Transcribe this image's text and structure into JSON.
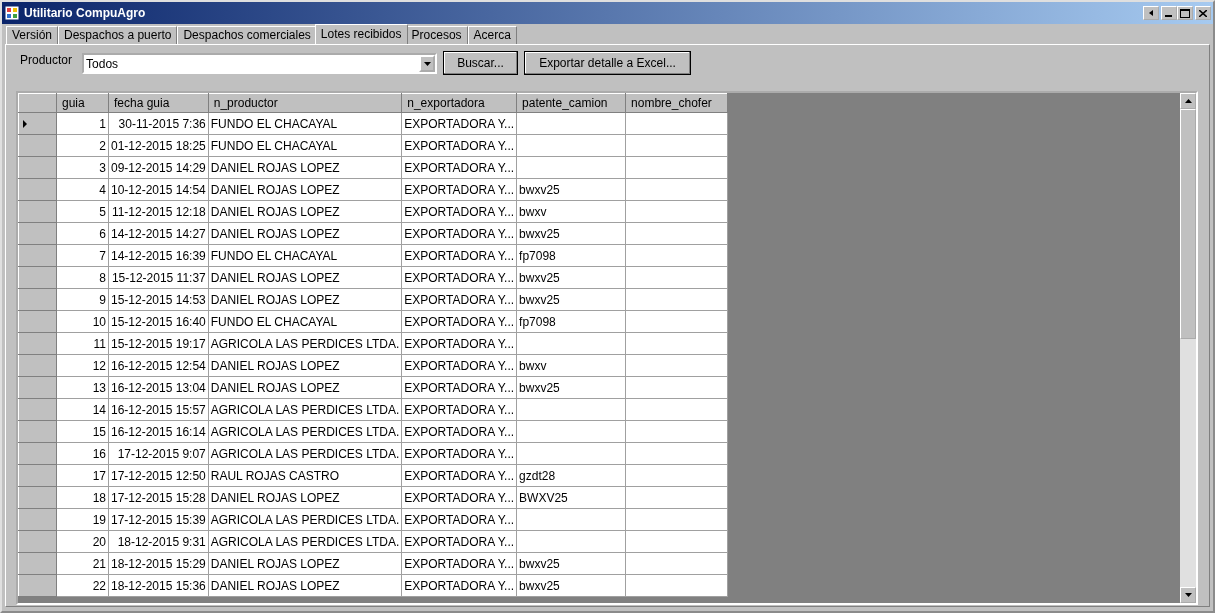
{
  "window": {
    "title": "Utilitario CompuAgro"
  },
  "tabs": [
    {
      "label": "Versión",
      "selected": false
    },
    {
      "label": "Despachos a puerto",
      "selected": false
    },
    {
      "label": "Despachos comerciales",
      "selected": false
    },
    {
      "label": "Lotes recibidos",
      "selected": true
    },
    {
      "label": "Procesos",
      "selected": false
    },
    {
      "label": "Acerca",
      "selected": false
    }
  ],
  "filter": {
    "label": "Productor",
    "value": "Todos"
  },
  "buttons": [
    "Buscar...",
    "Exportar detalle a Excel..."
  ],
  "table": {
    "columns": [
      "guia",
      "fecha guia",
      "n_productor",
      "n_exportadora",
      "patente_camion",
      "nombre_chofer"
    ],
    "rows": [
      {
        "selected": true,
        "cells": [
          "1",
          "30-11-2015 7:36",
          "FUNDO EL CHACAYAL",
          "EXPORTADORA Y...",
          "",
          ""
        ]
      },
      {
        "selected": false,
        "cells": [
          "2",
          "01-12-2015 18:25",
          "FUNDO EL CHACAYAL",
          "EXPORTADORA Y...",
          "",
          ""
        ]
      },
      {
        "selected": false,
        "cells": [
          "3",
          "09-12-2015 14:29",
          "DANIEL ROJAS LOPEZ",
          "EXPORTADORA Y...",
          "",
          ""
        ]
      },
      {
        "selected": false,
        "cells": [
          "4",
          "10-12-2015 14:54",
          "DANIEL ROJAS LOPEZ",
          "EXPORTADORA Y...",
          "bwxv25",
          ""
        ]
      },
      {
        "selected": false,
        "cells": [
          "5",
          "11-12-2015 12:18",
          "DANIEL ROJAS LOPEZ",
          "EXPORTADORA Y...",
          "bwxv",
          ""
        ]
      },
      {
        "selected": false,
        "cells": [
          "6",
          "14-12-2015 14:27",
          "DANIEL ROJAS LOPEZ",
          "EXPORTADORA Y...",
          "bwxv25",
          ""
        ]
      },
      {
        "selected": false,
        "cells": [
          "7",
          "14-12-2015 16:39",
          "FUNDO EL CHACAYAL",
          "EXPORTADORA Y...",
          "fp7098",
          ""
        ]
      },
      {
        "selected": false,
        "cells": [
          "8",
          "15-12-2015 11:37",
          "DANIEL ROJAS LOPEZ",
          "EXPORTADORA Y...",
          "bwxv25",
          ""
        ]
      },
      {
        "selected": false,
        "cells": [
          "9",
          "15-12-2015 14:53",
          "DANIEL ROJAS LOPEZ",
          "EXPORTADORA Y...",
          "bwxv25",
          ""
        ]
      },
      {
        "selected": false,
        "cells": [
          "10",
          "15-12-2015 16:40",
          "FUNDO EL CHACAYAL",
          "EXPORTADORA Y...",
          "fp7098",
          ""
        ]
      },
      {
        "selected": false,
        "cells": [
          "11",
          "15-12-2015 19:17",
          "AGRICOLA LAS PERDICES LTDA.",
          "EXPORTADORA Y...",
          "",
          ""
        ]
      },
      {
        "selected": false,
        "cells": [
          "12",
          "16-12-2015 12:54",
          "DANIEL ROJAS LOPEZ",
          "EXPORTADORA Y...",
          "bwxv",
          ""
        ]
      },
      {
        "selected": false,
        "cells": [
          "13",
          "16-12-2015 13:04",
          "DANIEL ROJAS LOPEZ",
          "EXPORTADORA Y...",
          "bwxv25",
          ""
        ]
      },
      {
        "selected": false,
        "cells": [
          "14",
          "16-12-2015 15:57",
          "AGRICOLA LAS PERDICES LTDA.",
          "EXPORTADORA Y...",
          "",
          ""
        ]
      },
      {
        "selected": false,
        "cells": [
          "15",
          "16-12-2015 16:14",
          "AGRICOLA LAS PERDICES LTDA.",
          "EXPORTADORA Y...",
          "",
          ""
        ]
      },
      {
        "selected": false,
        "cells": [
          "16",
          "17-12-2015 9:07",
          "AGRICOLA LAS PERDICES LTDA.",
          "EXPORTADORA Y...",
          "",
          ""
        ]
      },
      {
        "selected": false,
        "cells": [
          "17",
          "17-12-2015 12:50",
          "RAUL ROJAS CASTRO",
          "EXPORTADORA Y...",
          "gzdt28",
          ""
        ]
      },
      {
        "selected": false,
        "cells": [
          "18",
          "17-12-2015 15:28",
          "DANIEL ROJAS LOPEZ",
          "EXPORTADORA Y...",
          "BWXV25",
          ""
        ]
      },
      {
        "selected": false,
        "cells": [
          "19",
          "17-12-2015 15:39",
          "AGRICOLA LAS PERDICES LTDA.",
          "EXPORTADORA Y...",
          "",
          ""
        ]
      },
      {
        "selected": false,
        "cells": [
          "20",
          "18-12-2015 9:31",
          "AGRICOLA LAS PERDICES LTDA.",
          "EXPORTADORA Y...",
          "",
          ""
        ]
      },
      {
        "selected": false,
        "cells": [
          "21",
          "18-12-2015 15:29",
          "DANIEL ROJAS LOPEZ",
          "EXPORTADORA Y...",
          "bwxv25",
          ""
        ]
      },
      {
        "selected": false,
        "cells": [
          "22",
          "18-12-2015 15:36",
          "DANIEL ROJAS LOPEZ",
          "EXPORTADORA Y...",
          "bwxv25",
          ""
        ]
      }
    ]
  }
}
